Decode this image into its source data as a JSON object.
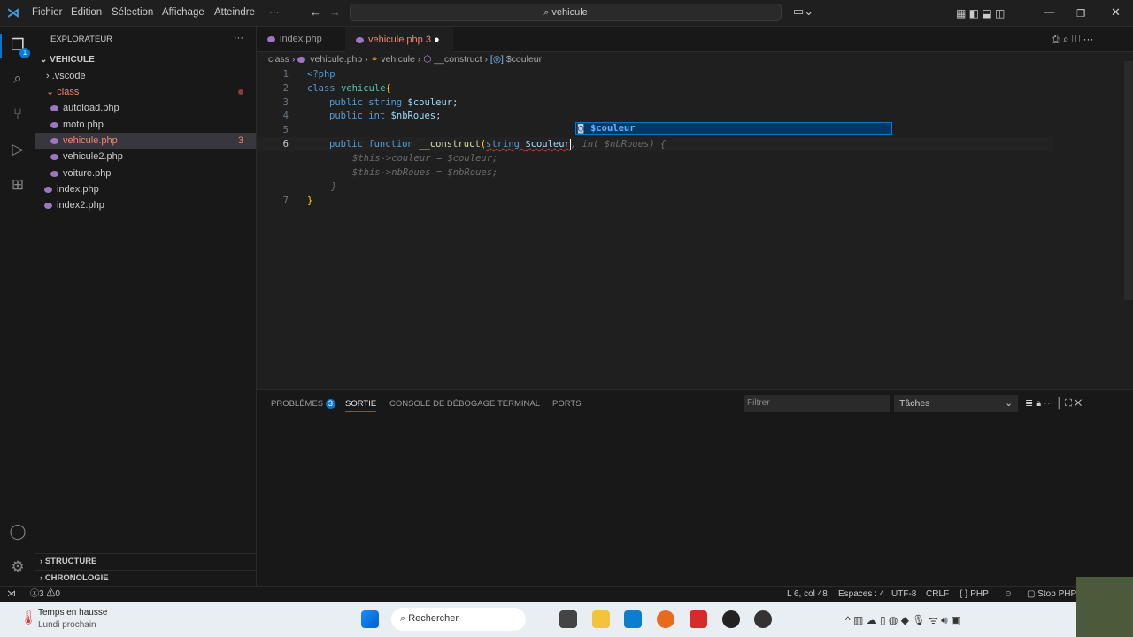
{
  "titlebar": {
    "menus": [
      "Fichier",
      "Edition",
      "Sélection",
      "Affichage",
      "Atteindre",
      "···"
    ],
    "search": "vehicule"
  },
  "sidebar": {
    "title": "EXPLORATEUR",
    "more": "···",
    "root": "VEHICULE",
    "items": [
      {
        "label": ".vscode"
      },
      {
        "label": "class"
      },
      {
        "label": "autoload.php"
      },
      {
        "label": "moto.php"
      },
      {
        "label": "vehicule.php",
        "badge": "3"
      },
      {
        "label": "vehicule2.php"
      },
      {
        "label": "voiture.php"
      },
      {
        "label": "index.php"
      },
      {
        "label": "index2.php"
      }
    ],
    "sections": [
      "STRUCTURE",
      "CHRONOLOGIE"
    ],
    "explorer_badge": "1"
  },
  "tabs": [
    {
      "label": "index.php"
    },
    {
      "label": "vehicule.php",
      "badge": "3"
    }
  ],
  "breadcrumb": [
    "class",
    "vehicule.php",
    "vehicule",
    "__construct",
    "$couleur"
  ],
  "code": {
    "l1": "<?php",
    "l2a": "class ",
    "l2b": "vehicule",
    "l2c": "{",
    "l3a": "public string ",
    "l3b": "$couleur",
    ";": ";",
    "l4a": "public int ",
    "l4b": "$nbRoues",
    "l6a": "public function ",
    "l6b": "__construct",
    "l6c": "(",
    "l6d": "string ",
    "l6e": "$couleur",
    "l6f": ", int $nbRoues) {",
    "g1": "$this->couleur = $couleur;",
    "g2": "$this->nbRoues = $nbRoues;",
    "g3": "}",
    "l7": "}"
  },
  "line_numbers": [
    "1",
    "2",
    "3",
    "4",
    "5",
    "6",
    "7"
  ],
  "suggestion": "$couleur",
  "panel": {
    "tabs": [
      "PROBLÈMES",
      "SORTIE",
      "CONSOLE DE DÉBOGAGE",
      "TERMINAL",
      "PORTS"
    ],
    "problems_count": "3",
    "filter_placeholder": "Filtrer",
    "select": "Tâches"
  },
  "status": {
    "errors": "3",
    "warnings": "0",
    "position": "L 6, col 48",
    "spaces": "Espaces : 4",
    "encoding": "UTF-8",
    "eol": "CRLF",
    "language": "PHP",
    "stop": "Stop PHP"
  },
  "taskbar": {
    "weather_title": "Temps en hausse",
    "weather_sub": "Lundi prochain",
    "search": "Rechercher"
  }
}
